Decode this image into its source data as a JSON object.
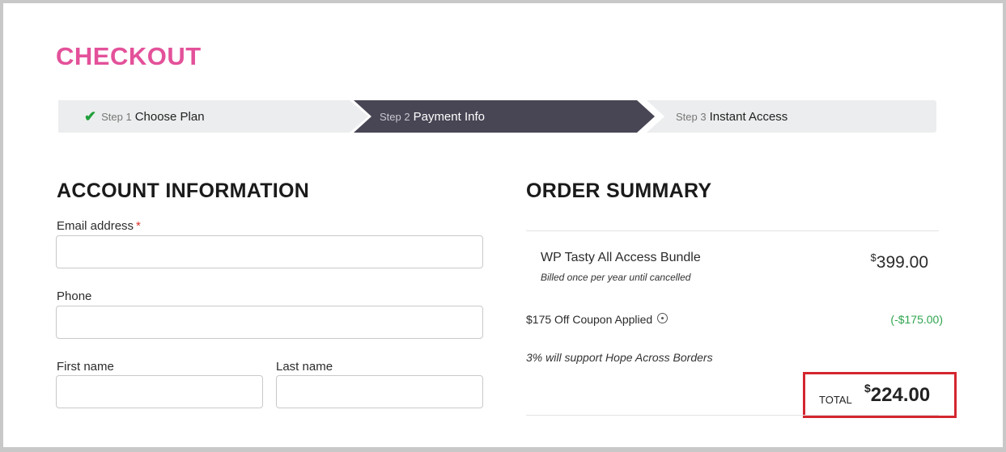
{
  "page": {
    "title": "CHECKOUT"
  },
  "stepper": {
    "steps": [
      {
        "num": "Step 1",
        "label": "Choose Plan",
        "state": "complete"
      },
      {
        "num": "Step 2",
        "label": "Payment Info",
        "state": "active"
      },
      {
        "num": "Step 3",
        "label": "Instant Access",
        "state": "upcoming"
      }
    ]
  },
  "account": {
    "heading": "ACCOUNT INFORMATION",
    "email": {
      "label": "Email address",
      "required_mark": "*",
      "value": ""
    },
    "phone": {
      "label": "Phone",
      "value": ""
    },
    "first_name": {
      "label": "First name",
      "value": ""
    },
    "last_name": {
      "label": "Last name",
      "value": ""
    }
  },
  "order": {
    "heading": "ORDER SUMMARY",
    "item": {
      "name": "WP Tasty All Access Bundle",
      "note": "Billed once per year until cancelled",
      "currency": "$",
      "price": "399.00"
    },
    "coupon": {
      "label": "$175 Off Coupon Applied",
      "amount": "(-$175.00)"
    },
    "charity_note": "3% will support Hope Across Borders",
    "total": {
      "label": "TOTAL",
      "currency": "$",
      "value": "224.00"
    }
  },
  "colors": {
    "title": "#e3519a",
    "active_step": "#484554",
    "inactive_step": "#ecedee",
    "check": "#21a03b",
    "discount": "#2ea44f",
    "highlight_box": "#d4262e"
  },
  "icons": {
    "step_complete": "check-icon",
    "coupon_info": "info-circle-icon"
  }
}
